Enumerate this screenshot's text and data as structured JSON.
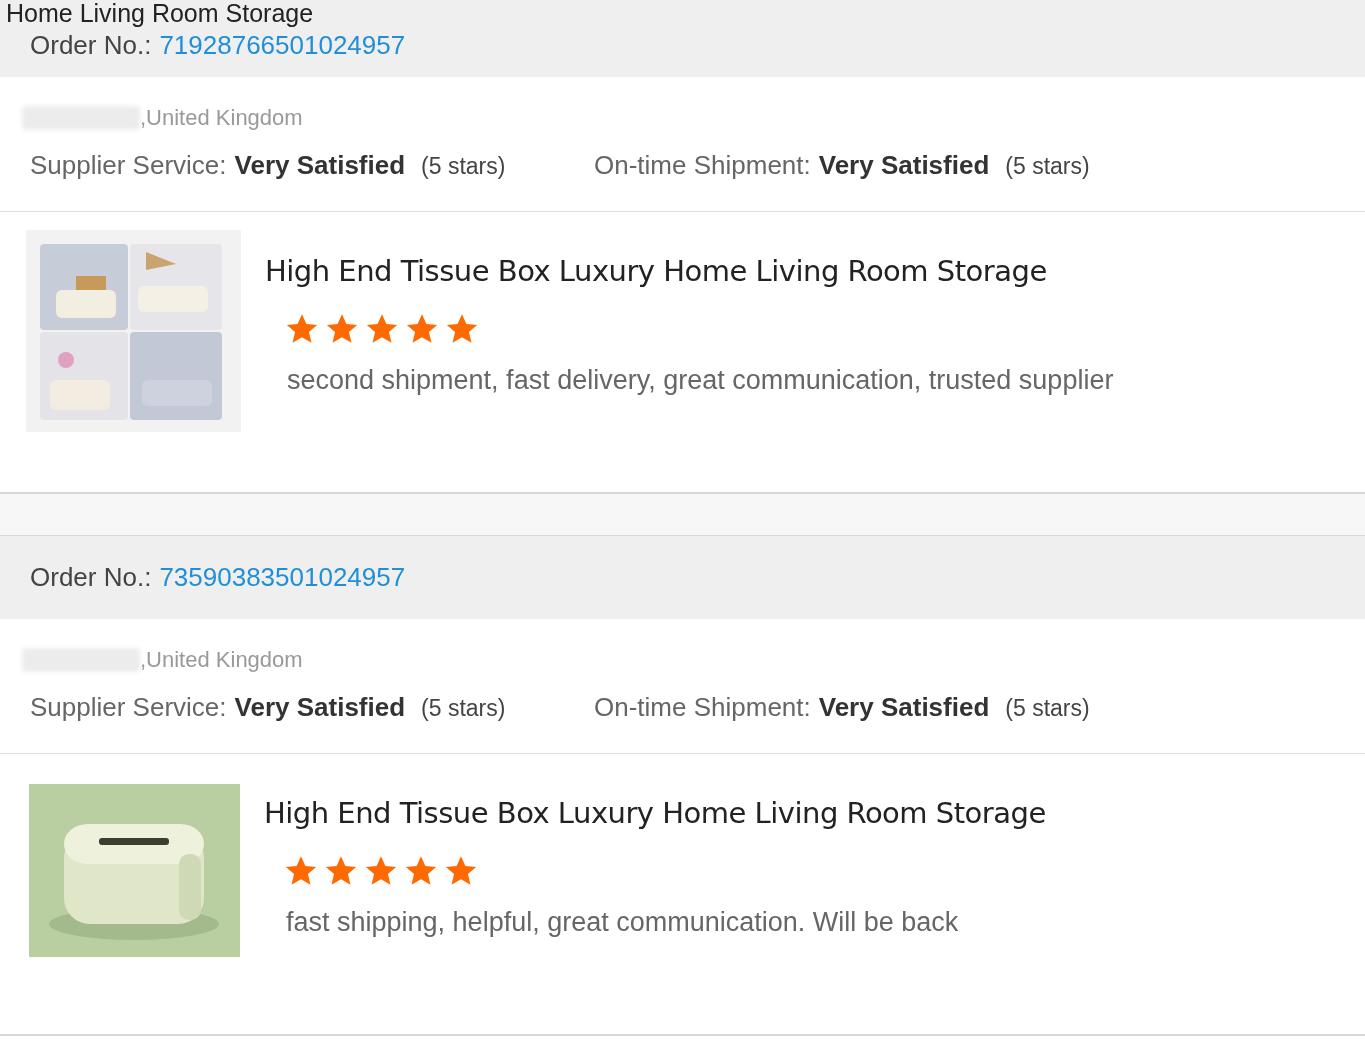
{
  "top_title": "Home Living Room Storage",
  "orders": [
    {
      "order_label": "Order No.:",
      "order_no": "71928766501024957",
      "location": ",United Kingdom",
      "ratings": [
        {
          "label": "Supplier Service:",
          "value": "Very Satisfied",
          "stars_text": "(5 stars)"
        },
        {
          "label": "On-time Shipment:",
          "value": "Very Satisfied",
          "stars_text": "(5 stars)"
        }
      ],
      "product": {
        "kind": "picture",
        "title": "High End Tissue Box Luxury Home Living Room Storage",
        "stars": 5,
        "comment": "second shipment, fast delivery, great communication, trusted supplier"
      }
    },
    {
      "order_label": "Order No.:",
      "order_no": "73590383501024957",
      "location": ",United Kingdom",
      "ratings": [
        {
          "label": "Supplier Service:",
          "value": "Very Satisfied",
          "stars_text": "(5 stars)"
        },
        {
          "label": "On-time Shipment:",
          "value": "Very Satisfied",
          "stars_text": "(5 stars)"
        }
      ],
      "product": {
        "kind": "picture",
        "title": "High End Tissue Box Luxury Home Living Room Storage",
        "stars": 5,
        "comment": "fast shipping, helpful, great communication. Will be back"
      }
    }
  ]
}
